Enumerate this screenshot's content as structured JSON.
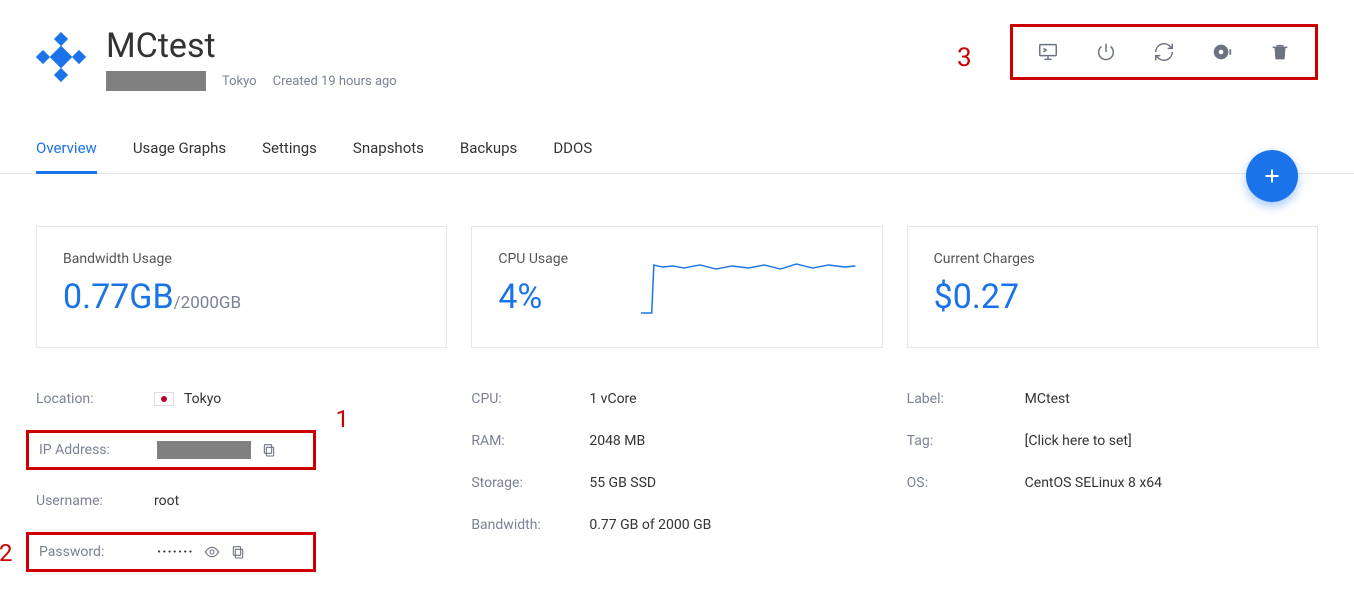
{
  "header": {
    "title": "MCtest",
    "location_short": "Tokyo",
    "created": "Created 19 hours ago"
  },
  "annotations": {
    "marker1": "1",
    "marker2": "2",
    "marker3": "3"
  },
  "tabs": [
    {
      "label": "Overview",
      "active": true
    },
    {
      "label": "Usage Graphs",
      "active": false
    },
    {
      "label": "Settings",
      "active": false
    },
    {
      "label": "Snapshots",
      "active": false
    },
    {
      "label": "Backups",
      "active": false
    },
    {
      "label": "DDOS",
      "active": false
    }
  ],
  "cards": {
    "bandwidth": {
      "label": "Bandwidth Usage",
      "value": "0.77GB",
      "suffix": "/2000GB"
    },
    "cpu": {
      "label": "CPU Usage",
      "value": "4%"
    },
    "charges": {
      "label": "Current Charges",
      "value": "$0.27"
    }
  },
  "details_left": {
    "location_label": "Location:",
    "location_value": "Tokyo",
    "ip_label": "IP Address:",
    "username_label": "Username:",
    "username_value": "root",
    "password_label": "Password:",
    "password_mask": "·······"
  },
  "details_mid": {
    "cpu_label": "CPU:",
    "cpu_value": "1 vCore",
    "ram_label": "RAM:",
    "ram_value": "2048 MB",
    "storage_label": "Storage:",
    "storage_value": "55 GB SSD",
    "bandwidth_label": "Bandwidth:",
    "bandwidth_value": "0.77 GB of 2000 GB"
  },
  "details_right": {
    "label_label": "Label:",
    "label_value": "MCtest",
    "tag_label": "Tag:",
    "tag_value": "[Click here to set]",
    "os_label": "OS:",
    "os_value": "CentOS SELinux 8 x64"
  }
}
